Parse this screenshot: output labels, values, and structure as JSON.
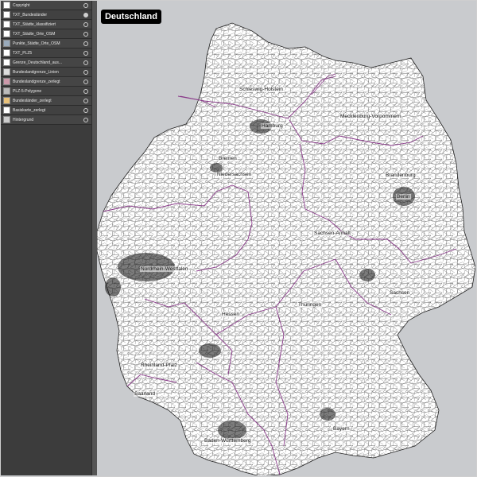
{
  "title": "Deutschland",
  "layers": [
    {
      "name": "Copyright",
      "visible": false
    },
    {
      "name": "TXT_Bundesländer",
      "visible": true
    },
    {
      "name": "TXT_Städte_klassifiziert",
      "visible": false
    },
    {
      "name": "TXT_Städte_Orte_OSM",
      "visible": false
    },
    {
      "name": "Punkte_Städte_Orte_OSM",
      "visible": false
    },
    {
      "name": "TXT_PLZ5",
      "visible": false
    },
    {
      "name": "Grenze_Deutschland_aus...",
      "visible": false
    },
    {
      "name": "Bundeslandgrenze_Linien",
      "visible": false
    },
    {
      "name": "Bundeslandgrenze_zerlegt",
      "visible": false
    },
    {
      "name": "PLZ-5-Polygone",
      "visible": false
    },
    {
      "name": "Bundesländer_zerlegt",
      "visible": false
    },
    {
      "name": "Basiskarte_zerlegt",
      "visible": false
    },
    {
      "name": "Hintergrund",
      "visible": false
    }
  ],
  "state_labels": {
    "schleswig_holstein": "Schleswig-Holstein",
    "hamburg": "Hamburg",
    "mecklenburg": "Mecklenburg-Vorpommern",
    "bremen": "Bremen",
    "niedersachsen": "Niedersachsen",
    "brandenburg": "Brandenburg",
    "berlin": "Berlin",
    "sachsen_anhalt": "Sachsen-Anhalt",
    "nrw": "Nordrhein-Westfalen",
    "sachsen": "Sachsen",
    "hessen": "Hessen",
    "thueringen": "Thüringen",
    "rheinland_pfalz": "Rheinland-Pfalz",
    "saarland": "Saarland",
    "bayern": "Bayern",
    "baden_wuerttemberg": "Baden-Württemberg"
  },
  "colors": {
    "panel_bg": "#3c3c3c",
    "map_bg": "#c9cbce",
    "country_fill": "#ffffff",
    "postcode_lines": "#222222",
    "state_border": "#8a3a8a",
    "title_bg": "#000000"
  }
}
